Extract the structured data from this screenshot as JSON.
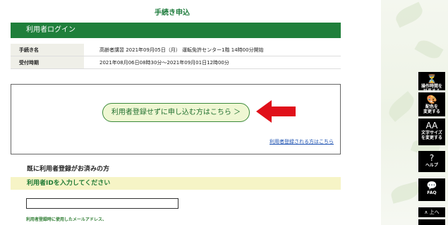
{
  "header": {
    "title": "手続き申込"
  },
  "login": {
    "bar_title": "利用者ログイン"
  },
  "info": [
    {
      "key": "手続き名",
      "value": "高齢者講習 2021年09月05日（月） 運転免許センター1階 14時00分開始"
    },
    {
      "key": "受付時期",
      "value": "2021年08月06日08時30分～2021年09月01日12時00分"
    }
  ],
  "card": {
    "proceed_label": "利用者登録せずに申し込む方はこちら ＞",
    "register_link": "利用者登録される方はこちら"
  },
  "registered": {
    "heading": "既に利用者登録がお済みの方",
    "band": "利用者IDを入力してください",
    "input_value": "",
    "hint": "利用者登録時に使用したメールアドレス、"
  },
  "sidebar": {
    "items": [
      {
        "icon": "⏳",
        "label1": "操作時間を",
        "label2": "延長する"
      },
      {
        "icon": "🎨",
        "label1": "配色を",
        "label2": "変更する"
      },
      {
        "icon": "AA",
        "label1": "文字サイズ",
        "label2": "を変更する"
      },
      {
        "icon": "?",
        "label1": "ヘルプ",
        "label2": ""
      },
      {
        "icon": "💬",
        "label1": "FAQ",
        "label2": ""
      }
    ],
    "top_label": "∧ 上へ"
  },
  "colors": {
    "brand_green": "#1f7f3b",
    "arrow_red": "#e0101a",
    "pill_bg": "#eff7d3",
    "band_bg": "#f6f4c6"
  }
}
